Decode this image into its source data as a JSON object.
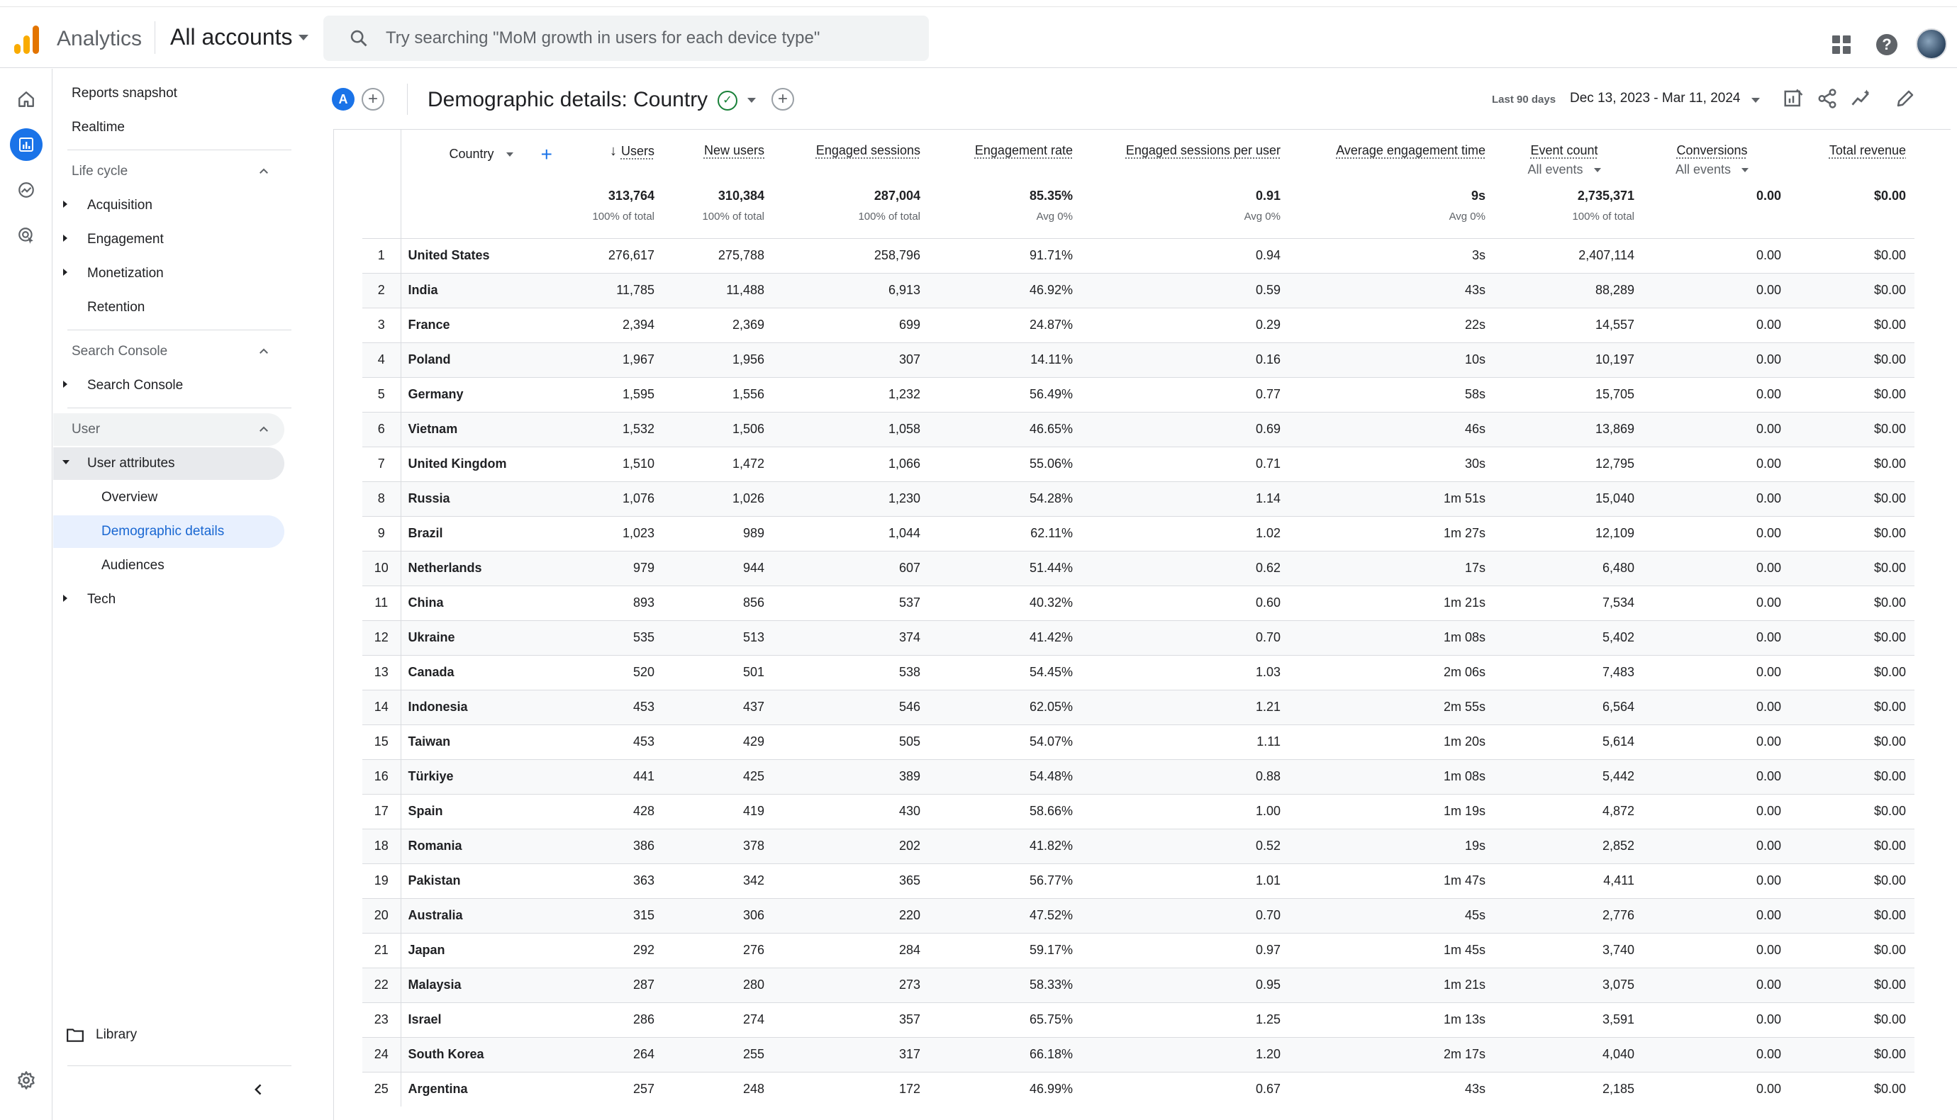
{
  "app": {
    "name": "Analytics",
    "account_selector": "All accounts",
    "search_placeholder": "Try searching \"MoM growth in users for each device type\""
  },
  "sidebar": {
    "reports_snapshot": "Reports snapshot",
    "realtime": "Realtime",
    "lifecycle_header": "Life cycle",
    "lifecycle_items": [
      "Acquisition",
      "Engagement",
      "Monetization",
      "Retention"
    ],
    "search_console_header": "Search Console",
    "search_console_item": "Search Console",
    "user_header": "User",
    "user_attributes": "User attributes",
    "user_attr_children": [
      "Overview",
      "Demographic details",
      "Audiences"
    ],
    "tech": "Tech",
    "library": "Library"
  },
  "report": {
    "badge": "A",
    "title": "Demographic details: Country",
    "date_label": "Last 90 days",
    "date_range": "Dec 13, 2023 - Mar 11, 2024"
  },
  "table": {
    "dimension_header": "Country",
    "columns": [
      {
        "label": "Users",
        "sub": ""
      },
      {
        "label": "New users",
        "sub": ""
      },
      {
        "label": "Engaged sessions",
        "sub": ""
      },
      {
        "label": "Engagement rate",
        "sub": ""
      },
      {
        "label": "Engaged sessions per user",
        "sub": ""
      },
      {
        "label": "Average engagement time",
        "sub": ""
      },
      {
        "label": "Event count",
        "sub": "All events"
      },
      {
        "label": "Conversions",
        "sub": "All events"
      },
      {
        "label": "Total revenue",
        "sub": ""
      }
    ],
    "totals": [
      {
        "v": "313,764",
        "s": "100% of total"
      },
      {
        "v": "310,384",
        "s": "100% of total"
      },
      {
        "v": "287,004",
        "s": "100% of total"
      },
      {
        "v": "85.35%",
        "s": "Avg 0%"
      },
      {
        "v": "0.91",
        "s": "Avg 0%"
      },
      {
        "v": "9s",
        "s": "Avg 0%"
      },
      {
        "v": "2,735,371",
        "s": "100% of total"
      },
      {
        "v": "0.00",
        "s": ""
      },
      {
        "v": "$0.00",
        "s": ""
      }
    ],
    "rows": [
      [
        "1",
        "United States",
        "276,617",
        "275,788",
        "258,796",
        "91.71%",
        "0.94",
        "3s",
        "2,407,114",
        "0.00",
        "$0.00"
      ],
      [
        "2",
        "India",
        "11,785",
        "11,488",
        "6,913",
        "46.92%",
        "0.59",
        "43s",
        "88,289",
        "0.00",
        "$0.00"
      ],
      [
        "3",
        "France",
        "2,394",
        "2,369",
        "699",
        "24.87%",
        "0.29",
        "22s",
        "14,557",
        "0.00",
        "$0.00"
      ],
      [
        "4",
        "Poland",
        "1,967",
        "1,956",
        "307",
        "14.11%",
        "0.16",
        "10s",
        "10,197",
        "0.00",
        "$0.00"
      ],
      [
        "5",
        "Germany",
        "1,595",
        "1,556",
        "1,232",
        "56.49%",
        "0.77",
        "58s",
        "15,705",
        "0.00",
        "$0.00"
      ],
      [
        "6",
        "Vietnam",
        "1,532",
        "1,506",
        "1,058",
        "46.65%",
        "0.69",
        "46s",
        "13,869",
        "0.00",
        "$0.00"
      ],
      [
        "7",
        "United Kingdom",
        "1,510",
        "1,472",
        "1,066",
        "55.06%",
        "0.71",
        "30s",
        "12,795",
        "0.00",
        "$0.00"
      ],
      [
        "8",
        "Russia",
        "1,076",
        "1,026",
        "1,230",
        "54.28%",
        "1.14",
        "1m 51s",
        "15,040",
        "0.00",
        "$0.00"
      ],
      [
        "9",
        "Brazil",
        "1,023",
        "989",
        "1,044",
        "62.11%",
        "1.02",
        "1m 27s",
        "12,109",
        "0.00",
        "$0.00"
      ],
      [
        "10",
        "Netherlands",
        "979",
        "944",
        "607",
        "51.44%",
        "0.62",
        "17s",
        "6,480",
        "0.00",
        "$0.00"
      ],
      [
        "11",
        "China",
        "893",
        "856",
        "537",
        "40.32%",
        "0.60",
        "1m 21s",
        "7,534",
        "0.00",
        "$0.00"
      ],
      [
        "12",
        "Ukraine",
        "535",
        "513",
        "374",
        "41.42%",
        "0.70",
        "1m 08s",
        "5,402",
        "0.00",
        "$0.00"
      ],
      [
        "13",
        "Canada",
        "520",
        "501",
        "538",
        "54.45%",
        "1.03",
        "2m 06s",
        "7,483",
        "0.00",
        "$0.00"
      ],
      [
        "14",
        "Indonesia",
        "453",
        "437",
        "546",
        "62.05%",
        "1.21",
        "2m 55s",
        "6,564",
        "0.00",
        "$0.00"
      ],
      [
        "15",
        "Taiwan",
        "453",
        "429",
        "505",
        "54.07%",
        "1.11",
        "1m 20s",
        "5,614",
        "0.00",
        "$0.00"
      ],
      [
        "16",
        "Türkiye",
        "441",
        "425",
        "389",
        "54.48%",
        "0.88",
        "1m 08s",
        "5,442",
        "0.00",
        "$0.00"
      ],
      [
        "17",
        "Spain",
        "428",
        "419",
        "430",
        "58.66%",
        "1.00",
        "1m 19s",
        "4,872",
        "0.00",
        "$0.00"
      ],
      [
        "18",
        "Romania",
        "386",
        "378",
        "202",
        "41.82%",
        "0.52",
        "19s",
        "2,852",
        "0.00",
        "$0.00"
      ],
      [
        "19",
        "Pakistan",
        "363",
        "342",
        "365",
        "56.77%",
        "1.01",
        "1m 47s",
        "4,411",
        "0.00",
        "$0.00"
      ],
      [
        "20",
        "Australia",
        "315",
        "306",
        "220",
        "47.52%",
        "0.70",
        "45s",
        "2,776",
        "0.00",
        "$0.00"
      ],
      [
        "21",
        "Japan",
        "292",
        "276",
        "284",
        "59.17%",
        "0.97",
        "1m 45s",
        "3,740",
        "0.00",
        "$0.00"
      ],
      [
        "22",
        "Malaysia",
        "287",
        "280",
        "273",
        "58.33%",
        "0.95",
        "1m 21s",
        "3,075",
        "0.00",
        "$0.00"
      ],
      [
        "23",
        "Israel",
        "286",
        "274",
        "357",
        "65.75%",
        "1.25",
        "1m 13s",
        "3,591",
        "0.00",
        "$0.00"
      ],
      [
        "24",
        "South Korea",
        "264",
        "255",
        "317",
        "66.18%",
        "1.20",
        "2m 17s",
        "4,040",
        "0.00",
        "$0.00"
      ],
      [
        "25",
        "Argentina",
        "257",
        "248",
        "172",
        "46.99%",
        "0.67",
        "43s",
        "2,185",
        "0.00",
        "$0.00"
      ]
    ]
  },
  "colors": {
    "accent": "#1a73e8",
    "logo_orange_dark": "#e37400",
    "logo_orange_light": "#f9ab00",
    "selected_bg": "#e8f0fe"
  }
}
